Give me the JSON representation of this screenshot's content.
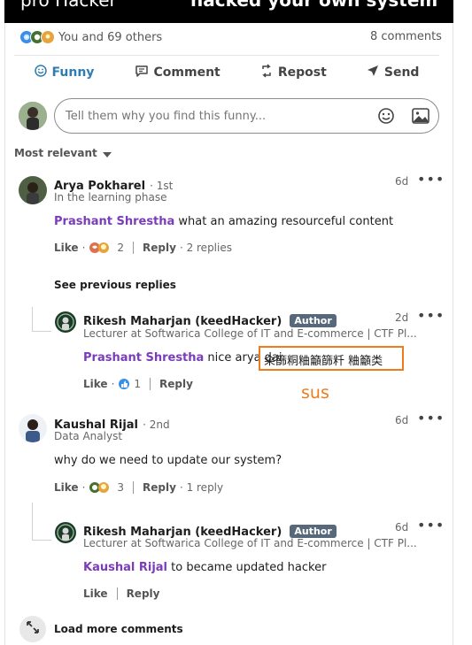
{
  "banner": {
    "left_text": "pro Hacker",
    "right_text": "hacked your own system"
  },
  "post": {
    "reactions_text": "You and 69 others",
    "comments_count": "8 comments"
  },
  "actions": {
    "funny": "Funny",
    "comment": "Comment",
    "repost": "Repost",
    "send": "Send"
  },
  "composer": {
    "placeholder": "Tell them why you find this funny..."
  },
  "sort": {
    "label": "Most relevant"
  },
  "comments": [
    {
      "name": "Arya Pokharel",
      "degree": "· 1st",
      "headline": "In the learning phase",
      "time": "6d",
      "mention": "Prashant Shrestha",
      "text": " what an amazing resourceful content",
      "like": "Like",
      "reaction_count": "2",
      "reply": "Reply",
      "replies": "· 2 replies"
    },
    {
      "name": "Kaushal Rijal",
      "degree": "· 2nd",
      "headline": "Data Analyst",
      "time": "6d",
      "text": "why do we need to update our system?",
      "like": "Like",
      "reaction_count": "3",
      "reply": "Reply",
      "replies": "· 1 reply"
    }
  ],
  "see_previous": "See previous replies",
  "replies": [
    {
      "name": "Rikesh Maharjan (keedHacker)",
      "badge": "Author",
      "headline": "Lecturer at Softwarica College of IT and E-commerce | CTF Pl...",
      "time": "2d",
      "mention": "Prashant Shrestha",
      "text": " nice arya dai",
      "garbled": "籴篩粡粬籲篩粁 粬籲类",
      "like": "Like",
      "reaction_count": "1",
      "reply": "Reply"
    },
    {
      "name": "Rikesh Maharjan (keedHacker)",
      "badge": "Author",
      "headline": "Lecturer at Softwarica College of IT and E-commerce | CTF Pl...",
      "time": "6d",
      "mention": "Kaushal Rijal",
      "text": " to became updated hacker",
      "like": "Like",
      "reply": "Reply"
    }
  ],
  "annotation": "sus",
  "load_more": "Load more comments",
  "colors": {
    "mention": "#7a3cb8",
    "active_action": "#2e7db2",
    "highlight": "#f07b1a",
    "author_badge": "#56687a"
  }
}
